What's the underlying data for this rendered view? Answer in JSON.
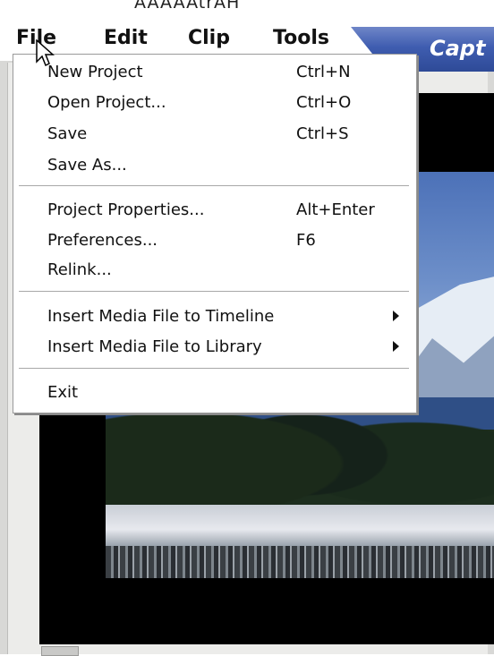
{
  "top_text": "AAAAAtrAH",
  "menubar": {
    "items": [
      {
        "label": "File",
        "name": "menu-file"
      },
      {
        "label": "Edit",
        "name": "menu-edit"
      },
      {
        "label": "Clip",
        "name": "menu-clip"
      },
      {
        "label": "Tools",
        "name": "menu-tools"
      }
    ],
    "tab_label": "Capt"
  },
  "file_menu": {
    "items": [
      {
        "label": "New Project",
        "shortcut": "Ctrl+N"
      },
      {
        "label": "Open Project...",
        "shortcut": "Ctrl+O"
      },
      {
        "label": "Save",
        "shortcut": "Ctrl+S"
      },
      {
        "label": "Save As...",
        "shortcut": ""
      },
      {
        "label": "Project Properties...",
        "shortcut": "Alt+Enter"
      },
      {
        "label": "Preferences...",
        "shortcut": "F6"
      },
      {
        "label": "Relink...",
        "shortcut": ""
      },
      {
        "label": "Insert Media File to Timeline",
        "shortcut": ""
      },
      {
        "label": "Insert Media File to Library",
        "shortcut": ""
      },
      {
        "label": "Exit",
        "shortcut": ""
      }
    ]
  },
  "colors": {
    "tab_blue": "#3f5db0",
    "menu_bg": "#ffffff",
    "preview_bg": "#000000"
  },
  "icons": {
    "cursor": "arrow-cursor-icon",
    "submenu": "submenu-arrow-icon"
  }
}
